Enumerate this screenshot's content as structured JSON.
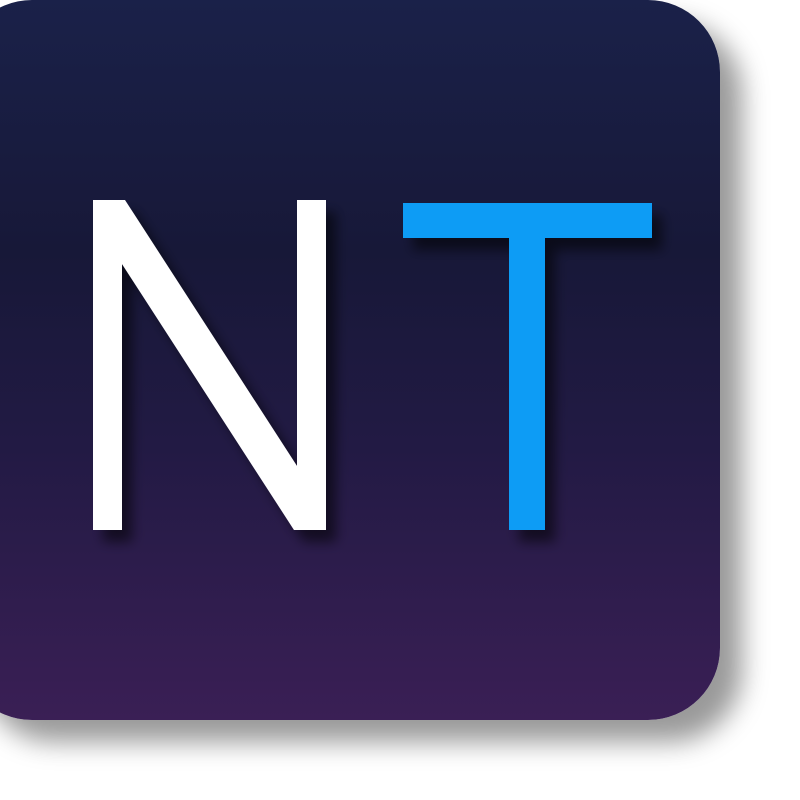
{
  "logo": {
    "letter_1": "N",
    "letter_2": "T",
    "colors": {
      "letter_1": "#ffffff",
      "letter_2": "#0a9cf5",
      "background_top": "#1a2149",
      "background_bottom": "#3a1f55"
    }
  }
}
